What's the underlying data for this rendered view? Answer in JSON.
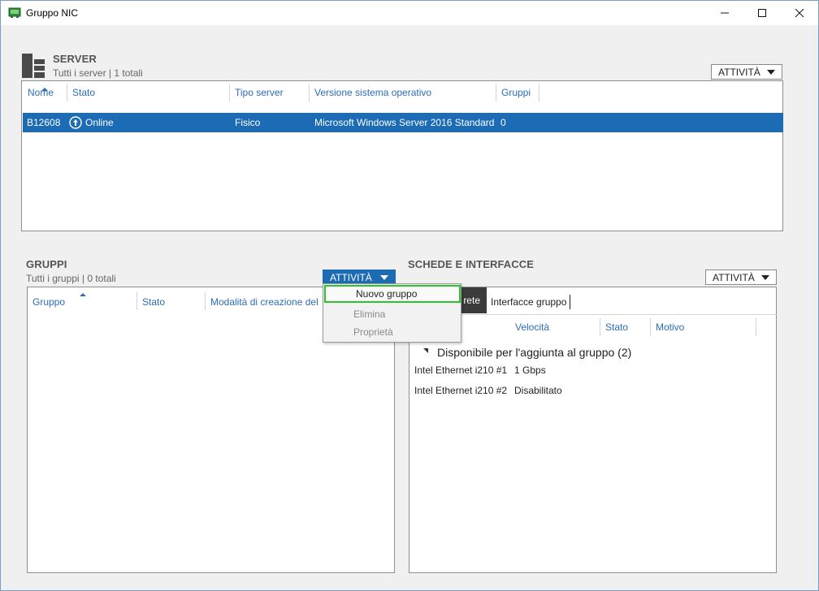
{
  "window": {
    "title": "Gruppo NIC",
    "minimize_icon": "minimize-icon",
    "maximize_icon": "maximize-icon",
    "close_icon": "close-icon"
  },
  "server": {
    "title": "SERVER",
    "subtitle": "Tutti i server | 1 totali",
    "tasks_label": "ATTIVITÀ",
    "columns": [
      "Nome",
      "Stato",
      "Tipo server",
      "Versione sistema operativo",
      "Gruppi"
    ],
    "rows": [
      {
        "name": "B12608",
        "status": "Online",
        "type": "Fisico",
        "os": "Microsoft Windows Server 2016 Standard",
        "groups": "0"
      }
    ]
  },
  "groups": {
    "title": "GRUPPI",
    "subtitle": "Tutti i gruppi | 0 totali",
    "tasks_label": "ATTIVITÀ",
    "columns": [
      "Gruppo",
      "Stato",
      "Modalità di creazione del"
    ]
  },
  "tasks_menu": {
    "items": [
      {
        "label": "Nuovo gruppo",
        "enabled": true
      },
      {
        "label": "Elimina",
        "enabled": false
      },
      {
        "label": "Proprietà",
        "enabled": false
      }
    ]
  },
  "interfaces": {
    "title": "SCHEDE E INTERFACCE",
    "tasks_label": "ATTIVITÀ",
    "tabs": [
      "rete",
      "Interfacce gruppo"
    ],
    "columns": [
      "Velocità",
      "Stato",
      "Motivo"
    ],
    "group_header": "Disponibile per l'aggiunta al gruppo (2)",
    "rows": [
      {
        "name": "Intel Ethernet i210 #1",
        "speed": "1 Gbps"
      },
      {
        "name": "Intel Ethernet i210 #2",
        "speed": "Disabilitato"
      }
    ]
  },
  "colors": {
    "selection": "#1c6bb5",
    "header_text": "#2a6ebb",
    "highlight_border": "#2ec32e"
  }
}
